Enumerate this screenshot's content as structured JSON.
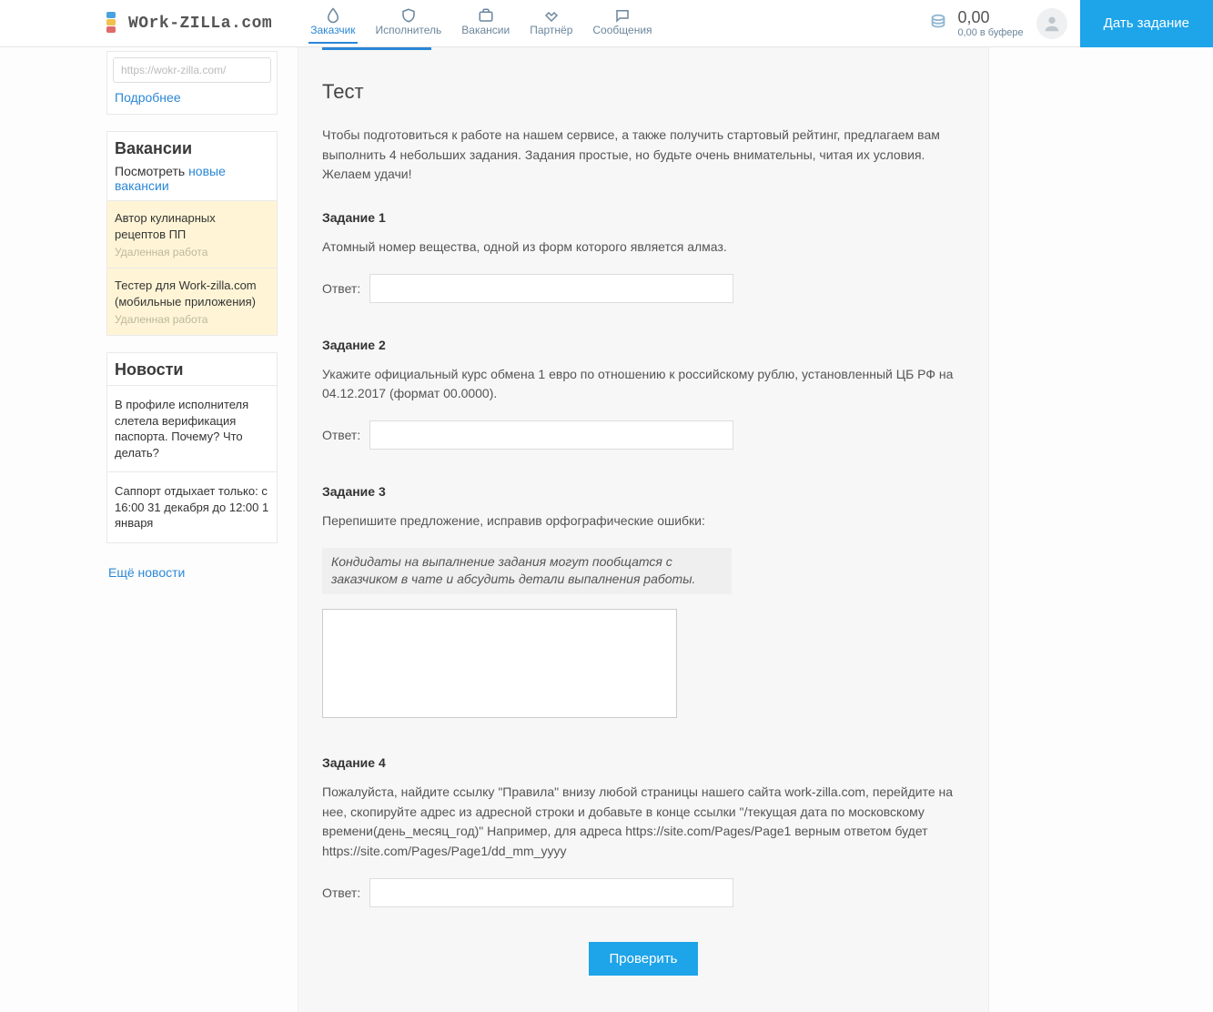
{
  "header": {
    "logo_text": "WOrk-ZILLa.com",
    "nav": [
      {
        "id": "customer",
        "label": "Заказчик"
      },
      {
        "id": "executor",
        "label": "Исполнитель"
      },
      {
        "id": "vacancy",
        "label": "Вакансии"
      },
      {
        "id": "partner",
        "label": "Партнёр"
      },
      {
        "id": "messages",
        "label": "Сообщения"
      }
    ],
    "balance_amount": "0,00",
    "balance_buffer": "0,00 в буфере",
    "cta": "Дать задание"
  },
  "sidebar": {
    "url_stub": "https://wokr-zilla.com/",
    "more_link": "Подробнее",
    "vac_title": "Вакансии",
    "vac_see_prefix": "Посмотреть ",
    "vac_see_link": "новые вакансии",
    "vac_items": [
      {
        "title": "Автор кулинарных рецептов ПП",
        "sub": "Удаленная работа"
      },
      {
        "title": "Тестер для Work-zilla.com (мобильные приложения)",
        "sub": "Удаленная работа"
      }
    ],
    "news_title": "Новости",
    "news_items": [
      "В профиле исполнителя слетела верификация паспорта. Почему? Что делать?",
      "Саппорт отдыхает только: с 16:00 31 декабря до 12:00 1 января"
    ],
    "news_more": "Ещё новости"
  },
  "main": {
    "title": "Тест",
    "intro": "Чтобы подготовиться к работе на нашем сервисе, а также получить стартовый рейтинг, предлагаем вам выполнить 4 небольших задания. Задания простые, но будьте очень внимательны, читая их условия. Желаем удачи!",
    "answer_label": "Ответ:",
    "tasks": {
      "t1": {
        "title": "Задание 1",
        "body": "Атомный номер вещества, одной из форм которого является алмаз."
      },
      "t2": {
        "title": "Задание 2",
        "body": "Укажите официальный курс обмена 1 евро по отношению к российскому рублю, установленный ЦБ РФ на 04.12.2017 (формат 00.0000)."
      },
      "t3": {
        "title": "Задание 3",
        "body": "Перепишите предложение, исправив орфографические ошибки:",
        "quote": "Кондидаты на выпалнение задания могут пообщатся с заказчиком в чате и абсудить детали выпалнения работы."
      },
      "t4": {
        "title": "Задание 4",
        "body": "Пожалуйста, найдите ссылку \"Правила\" внизу любой страницы нашего сайта work-zilla.com, перейдите на нее, скопируйте адрес из адресной строки и добавьте в конце ссылки \"/текущая дата по московскому времени(день_месяц_год)\" Например, для адреса https://site.com/Pages/Page1 верным ответом будет https://site.com/Pages/Page1/dd_mm_yyyy"
      }
    },
    "check_btn": "Проверить"
  }
}
